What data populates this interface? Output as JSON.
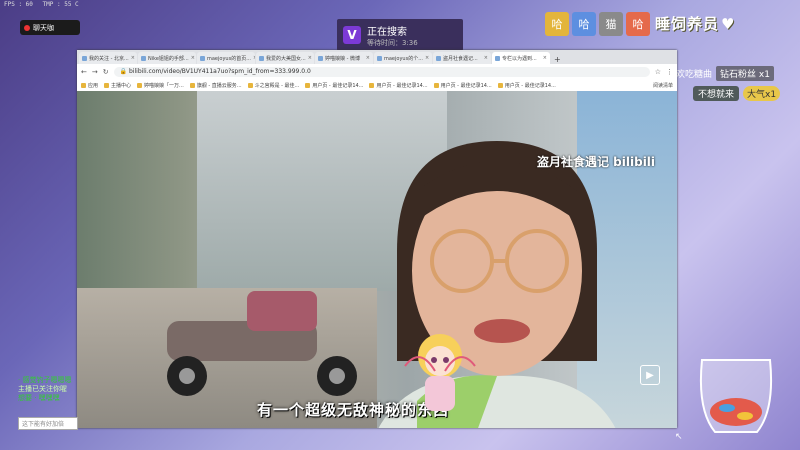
{
  "overlay": {
    "stats": [
      "FPS : 60",
      "TMP : 55 C"
    ],
    "rec_label": "聊天咖",
    "search_popup": {
      "icon": "V",
      "title": "正在搜索",
      "subtitle": "等待时间：3:36"
    },
    "badges": [
      "哈",
      "哈",
      "猫",
      "哈"
    ],
    "brand_title": "睡饲养员",
    "notice1": {
      "text": "很喜欢吃糖曲",
      "tag": "钻石粉丝 x1"
    },
    "notice2": {
      "pill": "不想就来",
      "coin": "大气x1"
    }
  },
  "browser": {
    "tabs": [
      {
        "label": "我的关注 - 北京...",
        "active": false
      },
      {
        "label": "Nike姐姐的手部...",
        "active": false
      },
      {
        "label": "maejoyus的首页...",
        "active": false
      },
      {
        "label": "我爱的大美国女...",
        "active": false
      },
      {
        "label": "婷喵娘娘 - 微博",
        "active": false
      },
      {
        "label": "maejoyus的个...",
        "active": false
      },
      {
        "label": "盗月社食遇记...",
        "active": false
      },
      {
        "label": "专栏以为遇到...",
        "active": true
      }
    ],
    "address": "bilibili.com/video/BV1UY411a7uo?spm_id_from=333.999.0.0",
    "bookmarks": [
      "应用",
      "主播中心",
      "婷喵娘娘「一万...",
      "旗舰 - 直播云服务...",
      "斗之宫殿是 - 最佳...",
      "用户页 - 最佳记录14...",
      "用户页 - 最佳记录14...",
      "用户页 - 最佳记录14...",
      "用户页 - 最佳记录14..."
    ],
    "bookmarks_right": "阅读清单"
  },
  "video": {
    "watermark": "盗月社食遇记 bilibili",
    "subtitle": "有一个超级无敌神秘的东西"
  },
  "bottom_left": {
    "lines": [
      "· 感觉钓子嗯嗯嗯",
      "主播已关注你喔",
      "想要 · 嘿嘿嘿"
    ],
    "input_placeholder": "这下能有好加倍"
  }
}
